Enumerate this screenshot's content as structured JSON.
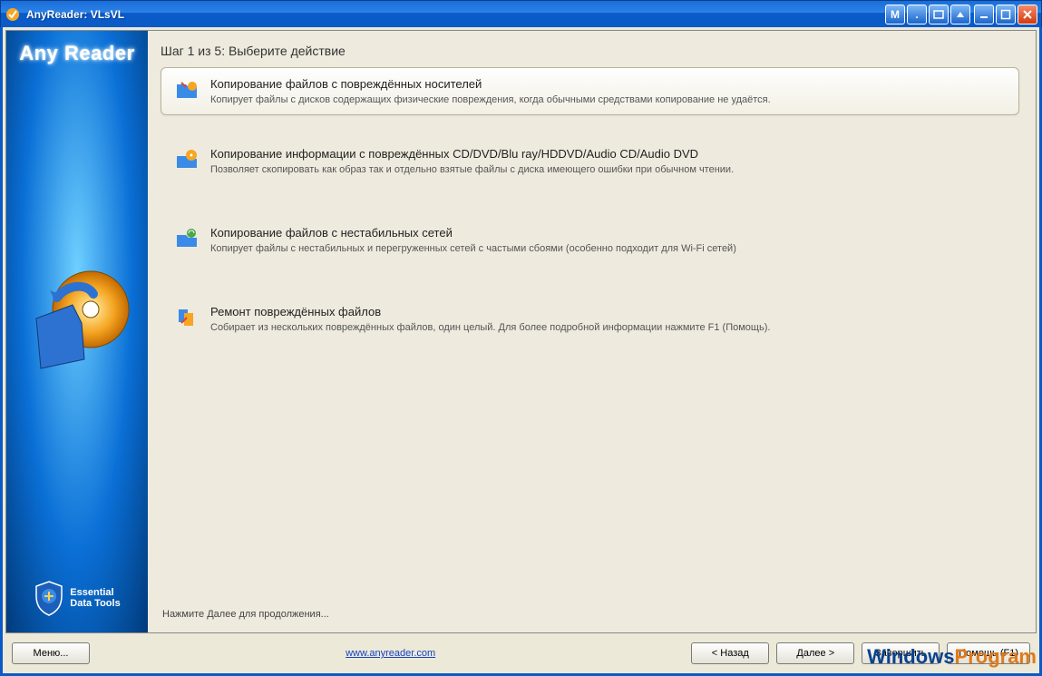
{
  "window": {
    "title": "AnyReader: VLsVL"
  },
  "sidebar": {
    "brand": "Any Reader",
    "footer_line1": "Essential",
    "footer_line2": "Data Tools"
  },
  "step": {
    "title": "Шаг 1 из 5: Выберите действие"
  },
  "options": [
    {
      "title": "Копирование файлов с повреждённых носителей",
      "desc": "Копирует файлы с дисков содержащих физические повреждения, когда обычными средствами копирование не удаётся."
    },
    {
      "title": "Копирование информации с повреждённых CD/DVD/Blu ray/HDDVD/Audio CD/Audio DVD",
      "desc": "Позволяет скопировать как образ так и отдельно взятые файлы с диска имеющего ошибки при обычном чтении."
    },
    {
      "title": "Копирование файлов с нестабильных сетей",
      "desc": "Копирует файлы с нестабильных и перегруженных сетей с частыми сбоями (особенно подходит для Wi-Fi сетей)"
    },
    {
      "title": "Ремонт повреждённых файлов",
      "desc": "Собирает из нескольких повреждённых файлов, один целый. Для более подробной информации нажмите F1 (Помощь)."
    }
  ],
  "status": "Нажмите Далее для продолжения...",
  "buttons": {
    "menu": "Меню...",
    "url": "www.anyreader.com",
    "back": "< Назад",
    "next": "Далее >",
    "finish": "Завершить",
    "help": "Помощь (F1)"
  },
  "watermark": {
    "part1": "Windows",
    "part2": "Program"
  }
}
